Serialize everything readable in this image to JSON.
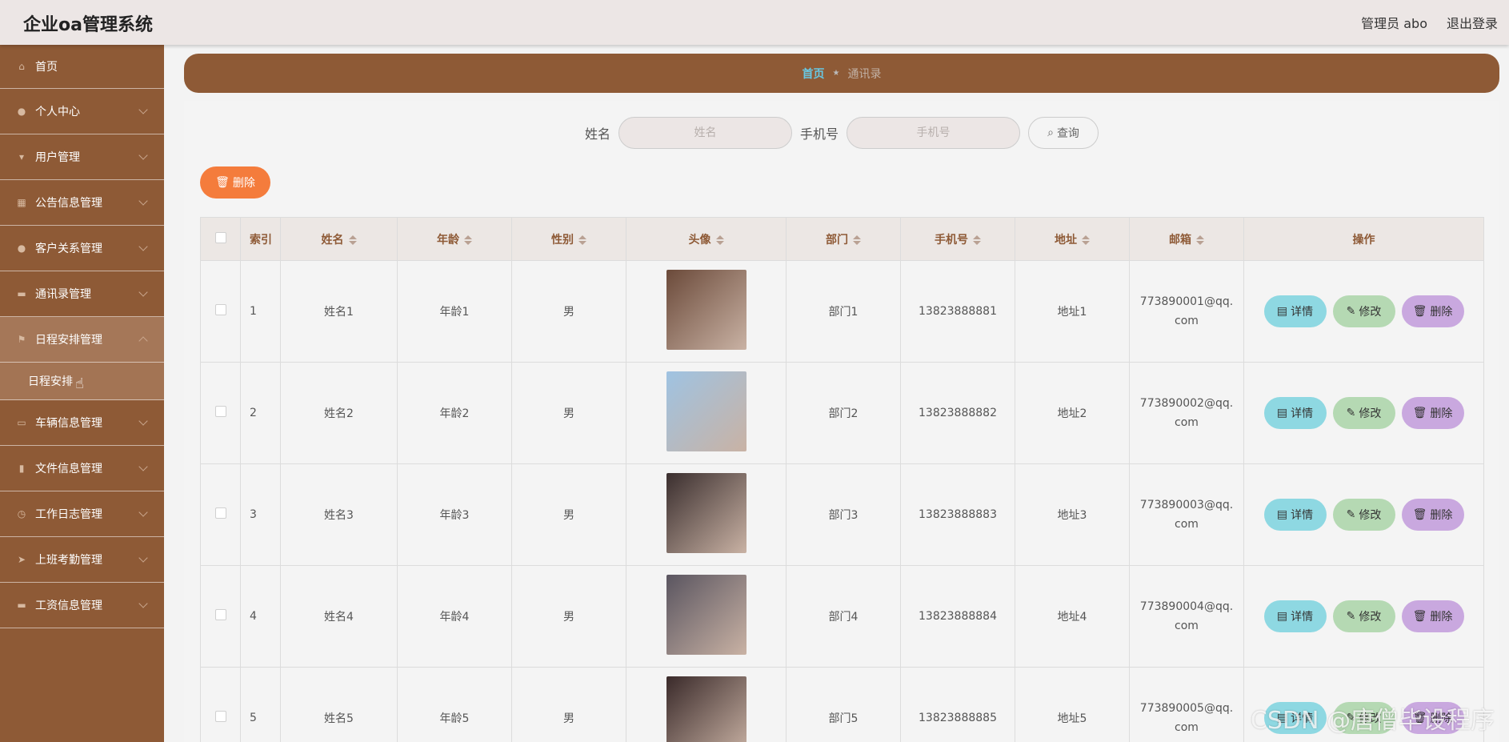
{
  "app_title": "企业oa管理系统",
  "header": {
    "admin_label": "管理员 abo",
    "logout": "退出登录"
  },
  "sidebar": {
    "items": [
      {
        "label": "首页",
        "icon": "home-icon"
      },
      {
        "label": "个人中心",
        "icon": "user-icon"
      },
      {
        "label": "用户管理",
        "icon": "users-icon"
      },
      {
        "label": "公告信息管理",
        "icon": "grid-icon"
      },
      {
        "label": "客户关系管理",
        "icon": "contact-icon"
      },
      {
        "label": "通讯录管理",
        "icon": "briefcase-icon"
      },
      {
        "label": "日程安排管理",
        "icon": "flag-icon"
      },
      {
        "label": "车辆信息管理",
        "icon": "chat-icon"
      },
      {
        "label": "文件信息管理",
        "icon": "clipboard-icon"
      },
      {
        "label": "工作日志管理",
        "icon": "clock-icon"
      },
      {
        "label": "上班考勤管理",
        "icon": "send-icon"
      },
      {
        "label": "工资信息管理",
        "icon": "card-icon"
      }
    ],
    "submenu": {
      "label": "日程安排"
    }
  },
  "breadcrumb": {
    "home": "首页",
    "current": "通讯录"
  },
  "search": {
    "name_label": "姓名",
    "name_placeholder": "姓名",
    "phone_label": "手机号",
    "phone_placeholder": "手机号",
    "button": "查询"
  },
  "bulk_delete": "删除",
  "table": {
    "headers": [
      "索引",
      "姓名",
      "年龄",
      "性别",
      "头像",
      "部门",
      "手机号",
      "地址",
      "邮箱",
      "操作"
    ],
    "rows": [
      {
        "index": "1",
        "name": "姓名1",
        "age": "年龄1",
        "gender": "男",
        "dept": "部门1",
        "phone": "13823888881",
        "address": "地址1",
        "email": "773890001@qq.com"
      },
      {
        "index": "2",
        "name": "姓名2",
        "age": "年龄2",
        "gender": "男",
        "dept": "部门2",
        "phone": "13823888882",
        "address": "地址2",
        "email": "773890002@qq.com"
      },
      {
        "index": "3",
        "name": "姓名3",
        "age": "年龄3",
        "gender": "男",
        "dept": "部门3",
        "phone": "13823888883",
        "address": "地址3",
        "email": "773890003@qq.com"
      },
      {
        "index": "4",
        "name": "姓名4",
        "age": "年龄4",
        "gender": "男",
        "dept": "部门4",
        "phone": "13823888884",
        "address": "地址4",
        "email": "773890004@qq.com"
      },
      {
        "index": "5",
        "name": "姓名5",
        "age": "年龄5",
        "gender": "男",
        "dept": "部门5",
        "phone": "13823888885",
        "address": "地址5",
        "email": "773890005@qq.com"
      }
    ],
    "actions": {
      "detail": "详情",
      "edit": "修改",
      "delete": "删除"
    }
  },
  "watermark": "CSDN @唐僧毕设程序",
  "colors": {
    "brand": "#8e5a36",
    "accent": "#f47c3c",
    "detail": "#8ed8e2",
    "edit": "#b5d9b3",
    "delete": "#c9a8df"
  }
}
